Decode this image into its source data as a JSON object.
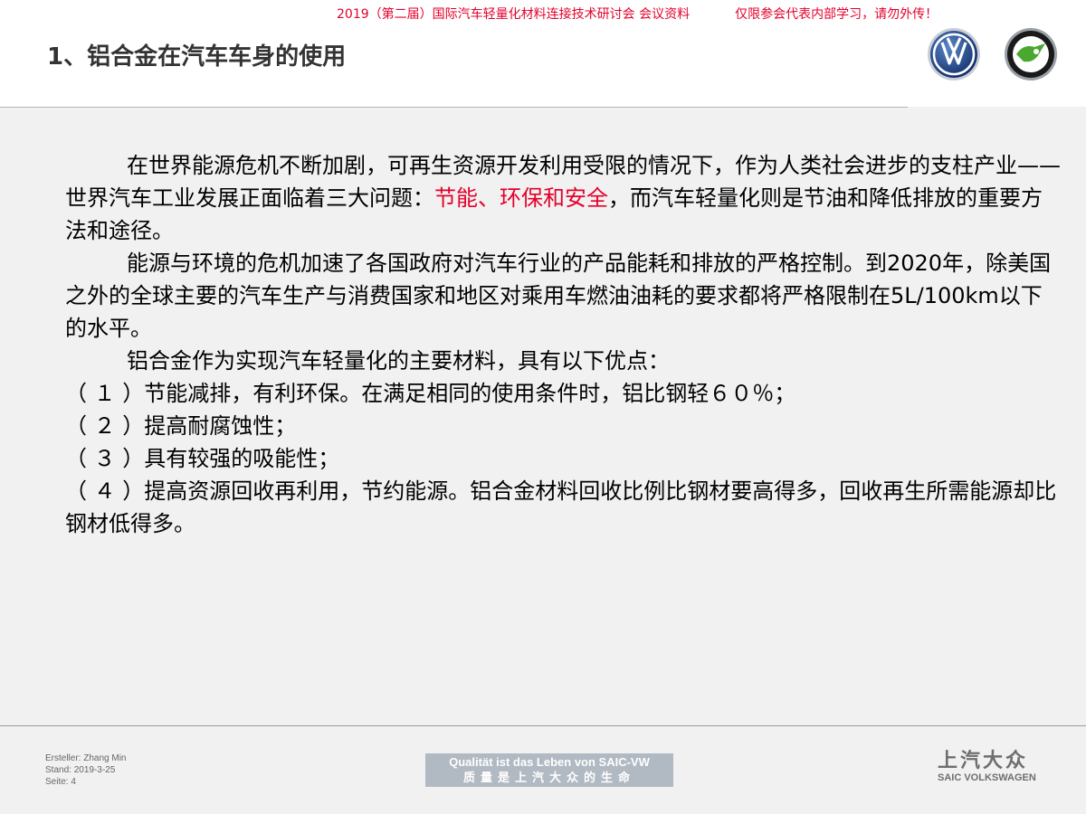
{
  "header": {
    "notice_left": "2019（第二届）国际汽车轻量化材料连接技术研讨会 会议资料",
    "notice_right": "仅限参会代表内部学习，请勿外传！",
    "title": "1、铝合金在汽车车身的使用"
  },
  "logos": {
    "vw": "vw-logo",
    "skoda": "skoda-logo"
  },
  "content": {
    "p1_a": "在世界能源危机不断加剧，可再生资源开发利用受限的情况下，作为人类社会进步的支柱产业——世界汽车工业发展正面临着三大问题：",
    "p1_highlight": "节能、环保和安全",
    "p1_b": "，而汽车轻量化则是节油和降低排放的重要方法和途径。",
    "p2": "能源与环境的危机加速了各国政府对汽车行业的产品能耗和排放的严格控制。到2020年，除美国之外的全球主要的汽车生产与消费国家和地区对乘用车燃油油耗的要求都将严格限制在5L/100km以下的水平。",
    "p3": "铝合金作为实现汽车轻量化的主要材料，具有以下优点：",
    "items": [
      "（ １ ）节能减排，有利环保。在满足相同的使用条件时，铝比钢轻６０％；",
      "（ ２ ）提高耐腐蚀性；",
      "（ ３ ）具有较强的吸能性；",
      "（ ４ ）提高资源回收再利用，节约能源。铝合金材料回收比例比钢材要高得多，回收再生所需能源却比钢材低得多。"
    ]
  },
  "footer": {
    "author": "Ersteller: Zhang Min",
    "date": "Stand: 2019-3-25",
    "page": "Seite: 4",
    "slogan_de": "Qualität ist das Leben von SAIC-VW",
    "slogan_cn": "质量是上汽大众的生命",
    "brand_cn": "上汽大众",
    "brand_en": "SAIC VOLKSWAGEN"
  },
  "colors": {
    "accent_red": "#e4002b",
    "vw_blue": "#1b3f86",
    "skoda_green": "#4ba82e"
  }
}
